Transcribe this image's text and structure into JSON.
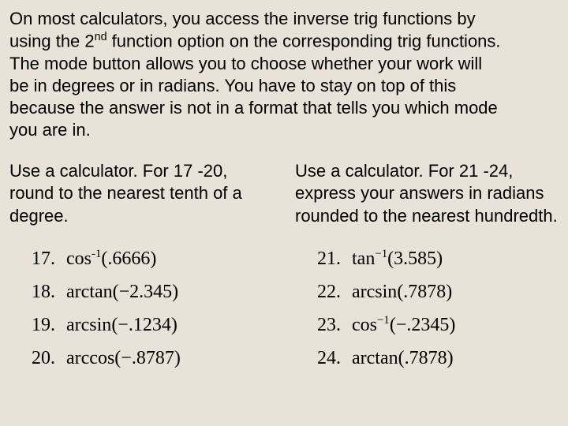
{
  "intro": {
    "line1": "On most calculators, you access the inverse trig functions by",
    "line2_a": "using the 2",
    "line2_sup": "nd",
    "line2_b": " function option on the corresponding trig functions.",
    "line3": "The mode button allows you to choose whether your work will",
    "line4": "be in degrees or in radians. You have to stay on top of this",
    "line5": "because the answer is not in a format that tells you which mode",
    "line6": "you are in."
  },
  "left": {
    "instruction": "Use a calculator. For 17 -20, round to the nearest tenth of a degree.",
    "problems": [
      {
        "num": "17.",
        "fn": "cos",
        "inv": "-1",
        "arg": "(.6666)"
      },
      {
        "num": "18.",
        "fn": "arctan",
        "inv": "",
        "arg": "(−2.345)"
      },
      {
        "num": "19.",
        "fn": "arcsin",
        "inv": "",
        "arg": "(−.1234)"
      },
      {
        "num": "20.",
        "fn": "arccos",
        "inv": "",
        "arg": "(−.8787)"
      }
    ]
  },
  "right": {
    "instruction": "Use a calculator. For 21 -24, express your answers in radians rounded to the nearest hundredth.",
    "problems": [
      {
        "num": "21.",
        "fn": "tan",
        "inv": "−1",
        "arg": "(3.585)"
      },
      {
        "num": "22.",
        "fn": "arcsin",
        "inv": "",
        "arg": "(.7878)"
      },
      {
        "num": "23.",
        "fn": "cos",
        "inv": "−1",
        "arg": "(−.2345)"
      },
      {
        "num": "24.",
        "fn": "arctan",
        "inv": "",
        "arg": "(.7878)"
      }
    ]
  }
}
